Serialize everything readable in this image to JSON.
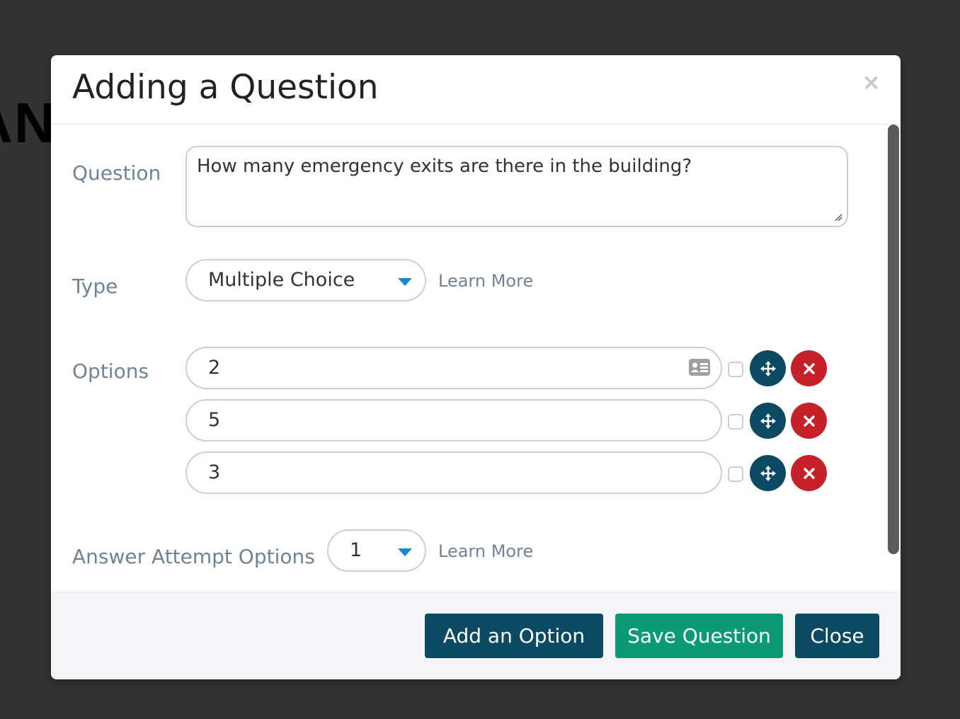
{
  "background": {
    "partial_text": "AN"
  },
  "modal": {
    "title": "Adding a Question",
    "close_glyph": "×",
    "question": {
      "label": "Question",
      "value": "How many emergency exits are there in the building?"
    },
    "type": {
      "label": "Type",
      "selected": "Multiple Choice",
      "learn_more": "Learn More"
    },
    "options": {
      "label": "Options",
      "items": [
        {
          "value": "2",
          "checked": false
        },
        {
          "value": "5",
          "checked": false
        },
        {
          "value": "3",
          "checked": false
        }
      ]
    },
    "answer_attempts": {
      "label": "Answer Attempt Options",
      "selected": "1",
      "learn_more": "Learn More"
    },
    "footer": {
      "add_option": "Add an Option",
      "save_question": "Save Question",
      "close": "Close"
    }
  },
  "colors": {
    "primary": "#0c4a64",
    "success": "#0a9a76",
    "danger": "#c62129",
    "caret": "#1a88d1",
    "label": "#6f8397"
  },
  "icons": [
    "close-icon",
    "caret-down-icon",
    "id-card-icon",
    "move-arrows-icon",
    "remove-x-icon",
    "resize-grip-icon"
  ]
}
